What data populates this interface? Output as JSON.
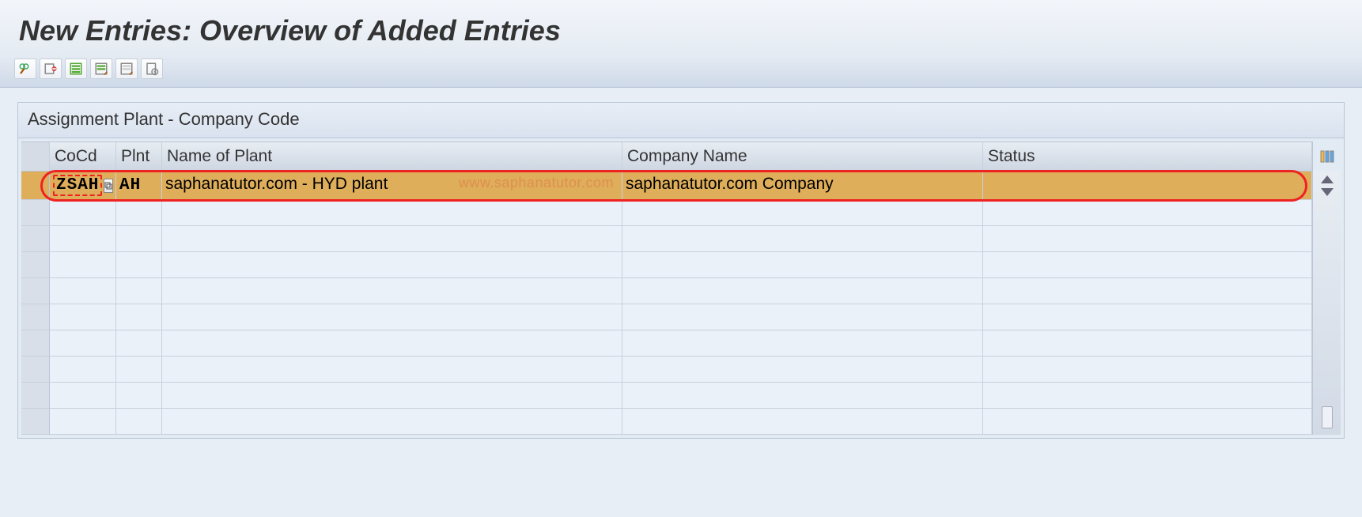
{
  "header": {
    "title": "New Entries: Overview of Added Entries"
  },
  "toolbar": {
    "buttons": [
      "display-change",
      "delimit",
      "select-all",
      "select-block",
      "deselect-all",
      "print"
    ]
  },
  "group": {
    "title": "Assignment Plant - Company Code"
  },
  "table": {
    "columns": {
      "cocd": "CoCd",
      "plnt": "Plnt",
      "name_of_plant": "Name of Plant",
      "company_name": "Company Name",
      "status": "Status"
    },
    "rows": [
      {
        "cocd": "ZSAH",
        "plnt": "AH",
        "name_of_plant": "saphanatutor.com - HYD plant",
        "company_name": "saphanatutor.com Company",
        "status": ""
      }
    ]
  },
  "watermark": "www.saphanatutor.com"
}
